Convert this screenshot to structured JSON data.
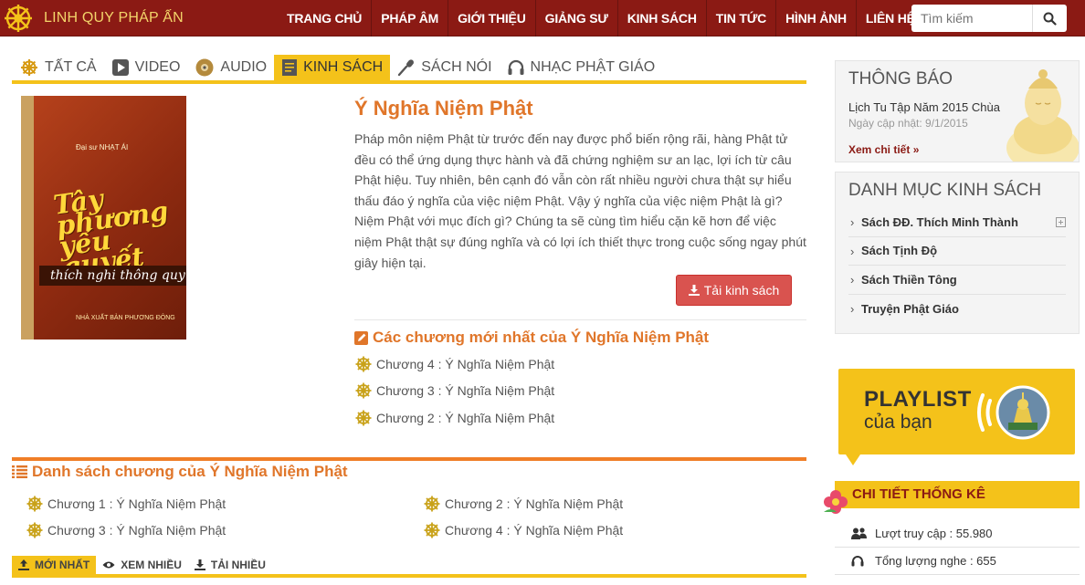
{
  "site": {
    "name": "LINH QUY PHÁP ẤN",
    "logo_icon": "dharma-wheel-icon"
  },
  "nav": [
    "TRANG CHỦ",
    "PHÁP ÂM",
    "GIỚI THIỆU",
    "GIẢNG SƯ",
    "KINH SÁCH",
    "TIN TỨC",
    "HÌNH ẢNH",
    "LIÊN HỆ"
  ],
  "search": {
    "placeholder": "Tìm kiếm"
  },
  "categories": [
    {
      "label": "TẤT CẢ",
      "icon": "dharma-wheel-icon"
    },
    {
      "label": "VIDEO",
      "icon": "play-icon"
    },
    {
      "label": "AUDIO",
      "icon": "disc-icon"
    },
    {
      "label": "KINH SÁCH",
      "icon": "book-icon",
      "active": true
    },
    {
      "label": "SÁCH NÓI",
      "icon": "microphone-icon"
    },
    {
      "label": "NHẠC PHẬT GIÁO",
      "icon": "headphones-icon"
    }
  ],
  "book": {
    "cover": {
      "author_line": "Đại sư NHẠT ÁI",
      "title_lines": [
        "Tây",
        "phương",
        "yếu",
        "quyết"
      ],
      "subtitle": "thích nghi thông quy",
      "publisher": "NHÀ XUẤT BẢN PHƯƠNG ĐÔNG"
    },
    "title": "Ý Nghĩa Niệm Phật",
    "description": "Pháp môn niệm Phật từ trước đến nay được phổ biến rộng rãi, hàng Phật tử đều có thể ứng dụng thực hành và đã chứng nghiệm sư an lạc, lợi ích từ câu Phật hiệu. Tuy nhiên, bên cạnh đó vẫn còn rất nhiều người chưa thật sự hiểu thấu đáo ý nghĩa của việc niệm Phật. Vậy ý nghĩa của việc niệm Phật là gì? Niệm Phật với mục đích gì? Chúng ta sẽ cùng tìm hiểu cặn kẽ hơn để việc niệm Phật thật sự đúng nghĩa và có lợi ích thiết thực trong cuộc sống ngay phút giây hiện tại.",
    "download_label": "Tải kinh sách"
  },
  "latest": {
    "heading": "Các chương mới nhất của Ý Nghĩa Niệm Phật",
    "items": [
      "Chương 4 : Ý Nghĩa Niệm Phật",
      "Chương 3 : Ý Nghĩa Niệm Phật",
      "Chương 2 : Ý Nghĩa Niệm Phật"
    ]
  },
  "chapters": {
    "heading": "Danh sách chương của Ý Nghĩa Niệm Phật",
    "items": [
      "Chương 1 : Ý Nghĩa Niệm Phật",
      "Chương 2 : Ý Nghĩa Niệm Phật",
      "Chương 3 : Ý Nghĩa Niệm Phật",
      "Chương 4 : Ý Nghĩa Niệm Phật"
    ]
  },
  "bottom_tabs": [
    {
      "label": "MỚI NHẤT",
      "icon": "upload-icon",
      "active": true
    },
    {
      "label": "XEM NHIỀU",
      "icon": "eye-icon"
    },
    {
      "label": "TẢI NHIỀU",
      "icon": "download-icon"
    }
  ],
  "sidebar": {
    "notice": {
      "heading": "THÔNG BÁO",
      "title": "Lịch Tu Tập Năm 2015 Chùa",
      "date": "Ngày cập nhật: 9/1/2015",
      "more": "Xem chi tiết »"
    },
    "catalog": {
      "heading": "DANH MỤC KINH SÁCH",
      "items": [
        {
          "label": "Sách ĐĐ. Thích Minh Thành",
          "expandable": true
        },
        {
          "label": "Sách Tịnh Độ"
        },
        {
          "label": "Sách Thiền Tông"
        },
        {
          "label": "Truyện Phật Giáo"
        }
      ]
    },
    "playlist": {
      "line1": "PLAYLIST",
      "line2": "của bạn"
    },
    "stats": {
      "heading": "CHI TIẾT THỐNG KÊ",
      "rows": [
        {
          "label": "Lượt truy cập : 55.980",
          "icon": "users-icon"
        },
        {
          "label": "Tổng lượng nghe : 655",
          "icon": "headphones-icon"
        }
      ]
    }
  },
  "colors": {
    "header": "#8b1a14",
    "accent": "#f4c21a",
    "title": "#e0762a",
    "button": "#d9534f"
  }
}
